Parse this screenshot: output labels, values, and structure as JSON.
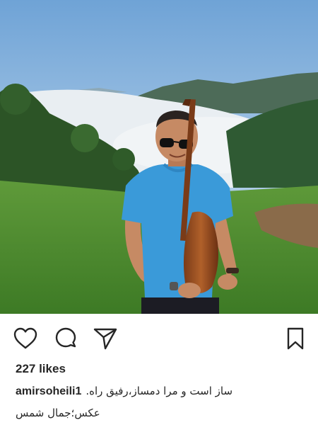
{
  "post": {
    "photo_name": "man-with-saz-in-mountains",
    "likes": "227 likes",
    "username": "amirsoheili1",
    "caption": "ساز است و مرا دمساز،رفیقِ راه.",
    "credit": "عکس؛جمال شمس"
  },
  "icons": {
    "like": "heart-icon",
    "comment": "comment-bubble-icon",
    "share": "paper-plane-icon",
    "save": "bookmark-icon"
  },
  "colors": {
    "text": "#262626",
    "background": "#ffffff",
    "shirt": "#3a9ad9"
  }
}
